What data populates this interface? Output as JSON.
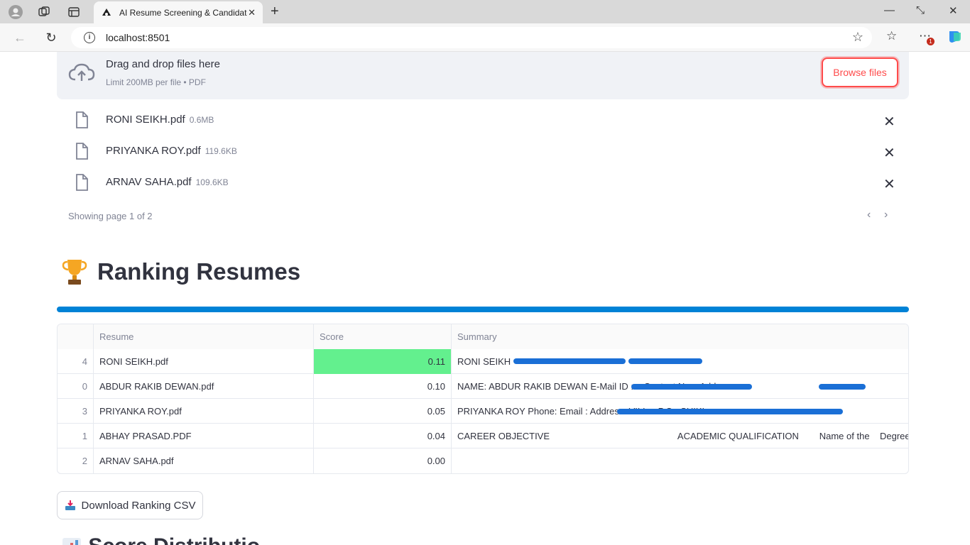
{
  "browser": {
    "tab_title": "AI Resume Screening & Candidate Ranking",
    "url": "localhost:8501",
    "notification_count": "1"
  },
  "uploader": {
    "title": "Drag and drop files here",
    "limit": "Limit 200MB per file • PDF",
    "browse_label": "Browse files",
    "files": [
      {
        "name": "RONI SEIKH.pdf",
        "size": "0.6MB"
      },
      {
        "name": "PRIYANKA ROY.pdf",
        "size": "119.6KB"
      },
      {
        "name": "ARNAV SAHA.pdf",
        "size": "109.6KB"
      }
    ],
    "pager": "Showing page 1 of 2"
  },
  "ranking": {
    "heading": "Ranking Resumes",
    "columns": [
      "",
      "Resume",
      "Score",
      "Summary"
    ],
    "rows": [
      {
        "idx": "4",
        "resume": "RONI SEIKH.pdf",
        "score": "0.11",
        "summary": "RONI SEIKH"
      },
      {
        "idx": "0",
        "resume": "ABDUR RAKIB DEWAN.pdf",
        "score": "0.10",
        "summary": "NAME:  ABDUR RAKIB DEWAN   E-Mail ID : a                                          Contact No. :                        Address"
      },
      {
        "idx": "3",
        "resume": "PRIYANKA ROY.pdf",
        "score": "0.05",
        "summary": "PRIYANKA ROY Phone: Email : Address:                                                                                       VILL + P.O : SHIKI"
      },
      {
        "idx": "1",
        "resume": "ABHAY PRASAD.PDF",
        "score": "0.04",
        "summary": "CAREER OBJECTIVE                                                  ACADEMIC QUALIFICATION        Name of the    Degree    N"
      },
      {
        "idx": "2",
        "resume": "ARNAV SAHA.pdf",
        "score": "0.00",
        "summary": ""
      }
    ],
    "highlight_color": "#63f08e",
    "download_label": "Download Ranking CSV"
  },
  "next_section": {
    "heading": "Score Distributio"
  },
  "colors": {
    "accent": "#ff4b4b",
    "divider": "#0082d6"
  }
}
